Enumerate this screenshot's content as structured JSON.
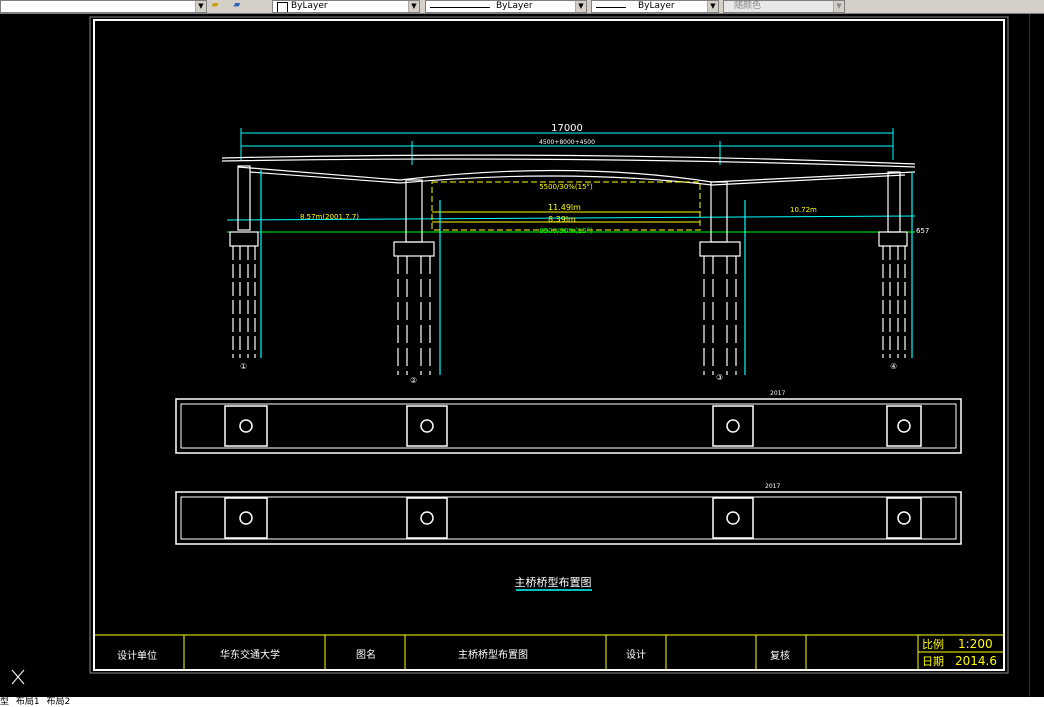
{
  "toolbar": {
    "layer_combo": "ByLayer",
    "linetype_combo": "ByLayer",
    "lineweight_combo": "ByLayer",
    "plotstyle_combo": "随颜色"
  },
  "drawing": {
    "overall_dim": "17000",
    "span_dim": "4500+8000+4500",
    "mid_dim_top": "5500/30%(15°)",
    "mid_dim_bottom": "6500/30%(15°)",
    "water_level_1": "11.49lm",
    "water_level_2": "8.39lm",
    "left_level": "8.57m(2001.7.7)",
    "right_level": "10.72m",
    "right_elev": "657",
    "pier_labels": [
      "①",
      "②",
      "③",
      "④"
    ],
    "plan_label": "2017",
    "title": "主桥桥型布置图"
  },
  "title_block": {
    "design_unit_label": "设计单位",
    "design_unit_value": "华东交通大学",
    "drawing_name_label": "图名",
    "drawing_name_value": "主桥桥型布置图",
    "design_label": "设计",
    "check_label": "复核",
    "scale_label": "比例",
    "scale_value": "1:200",
    "date_label": "日期",
    "date_value": "2014.6"
  },
  "tabs": [
    "型",
    "布局1",
    "布局2"
  ],
  "colors": {
    "accent_cyan": "#00ffff",
    "line_white": "#ffffff",
    "yellow": "#ffff00",
    "green": "#00ff00"
  }
}
